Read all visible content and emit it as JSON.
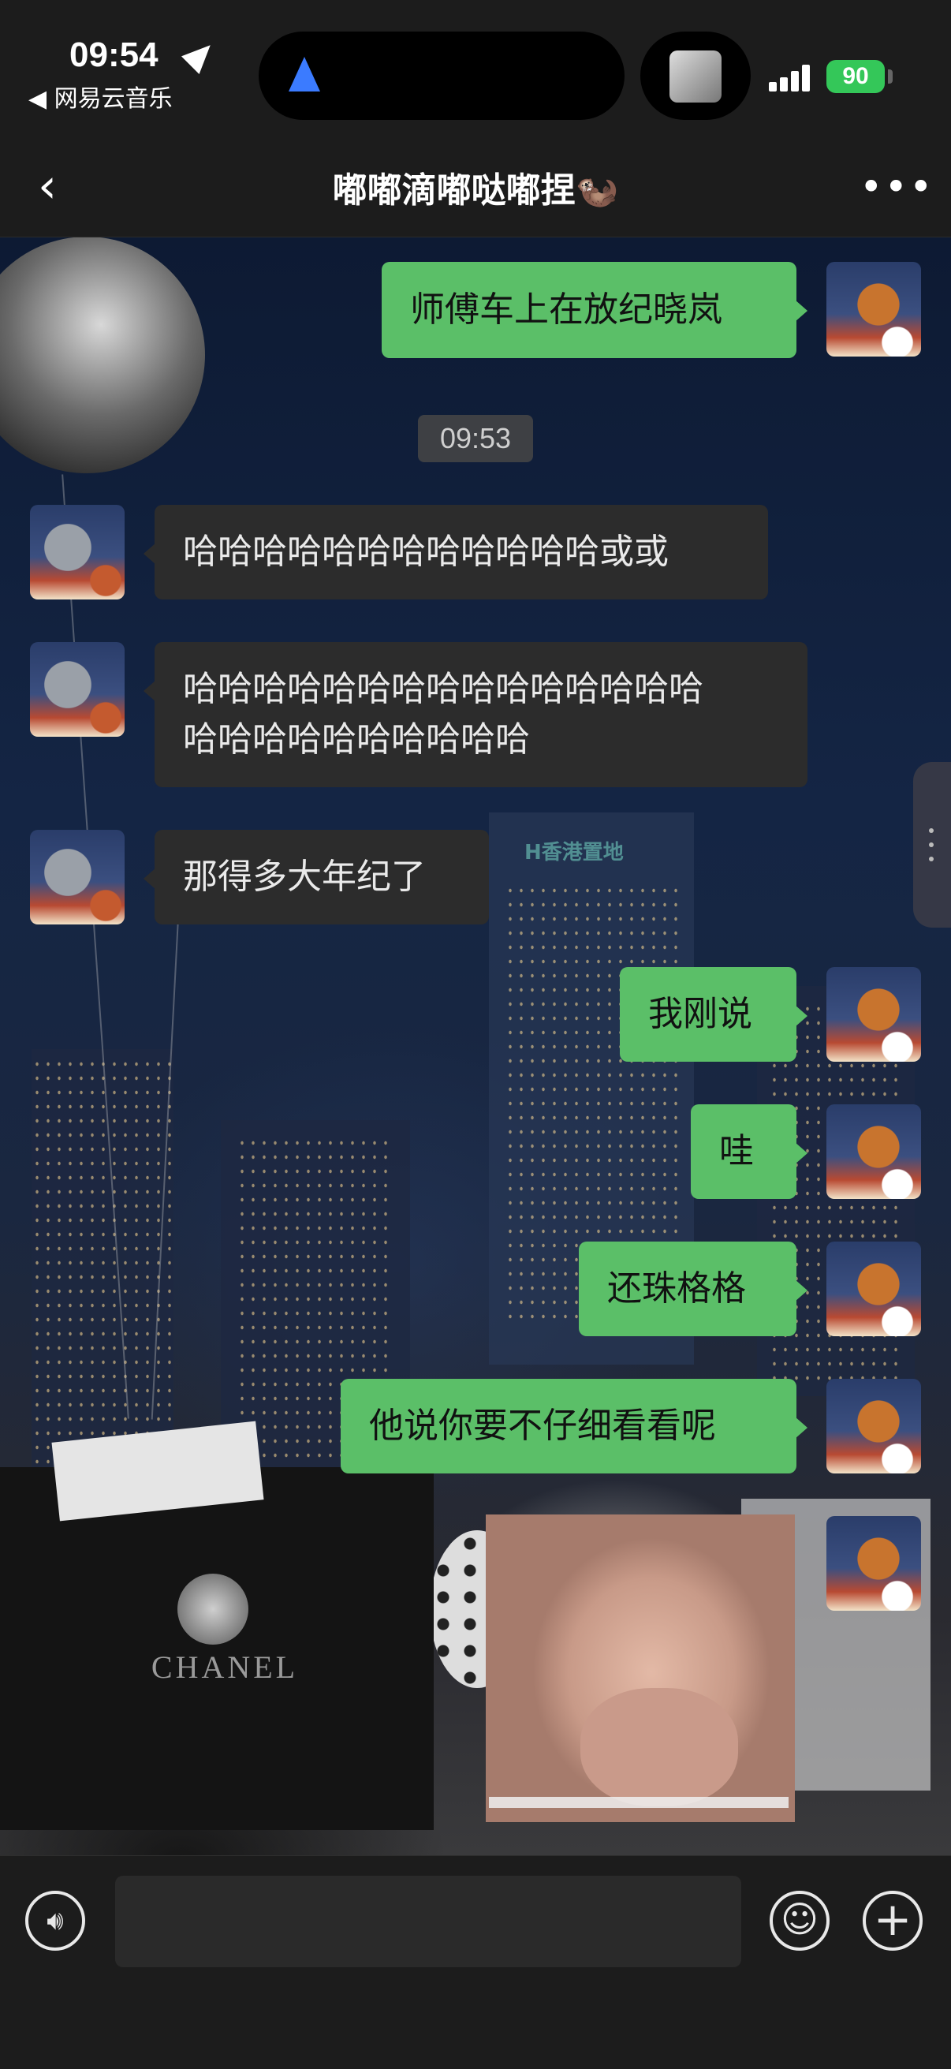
{
  "status_bar": {
    "time": "09:54",
    "back_app": "◀ 网易云音乐",
    "battery": "90"
  },
  "nav": {
    "back_icon": "chevron-left-icon",
    "title": "嘟嘟滴嘟哒嘟捏🦦",
    "more_icon": "more-icon"
  },
  "timestamp": "09:53",
  "messages": [
    {
      "side": "out",
      "text": "师傅车上在放纪晓岚"
    },
    {
      "side": "in",
      "text": "哈哈哈哈哈哈哈哈哈哈哈哈或或"
    },
    {
      "side": "in",
      "line1": "哈哈哈哈哈哈哈哈哈哈哈哈哈哈哈",
      "line2": "哈哈哈哈哈哈哈哈哈哈"
    },
    {
      "side": "in",
      "text": "那得多大年纪了"
    },
    {
      "side": "out",
      "text": "我刚说"
    },
    {
      "side": "out",
      "text": "哇"
    },
    {
      "side": "out",
      "text": "还珠格格"
    },
    {
      "side": "out",
      "text": "他说你要不仔细看看呢"
    }
  ],
  "background_text": {
    "sign": "H香港置地",
    "bag_brand": "CHANEL"
  },
  "input": {
    "value": "",
    "voice_icon": "voice-icon",
    "emoji_icon": "emoji-icon",
    "plus_icon": "plus-icon"
  },
  "colors": {
    "outgoing_bubble": "#5bbf68",
    "incoming_bubble": "#2c2c2c",
    "battery": "#34c759",
    "nav_arrow": "#3b7bff"
  }
}
